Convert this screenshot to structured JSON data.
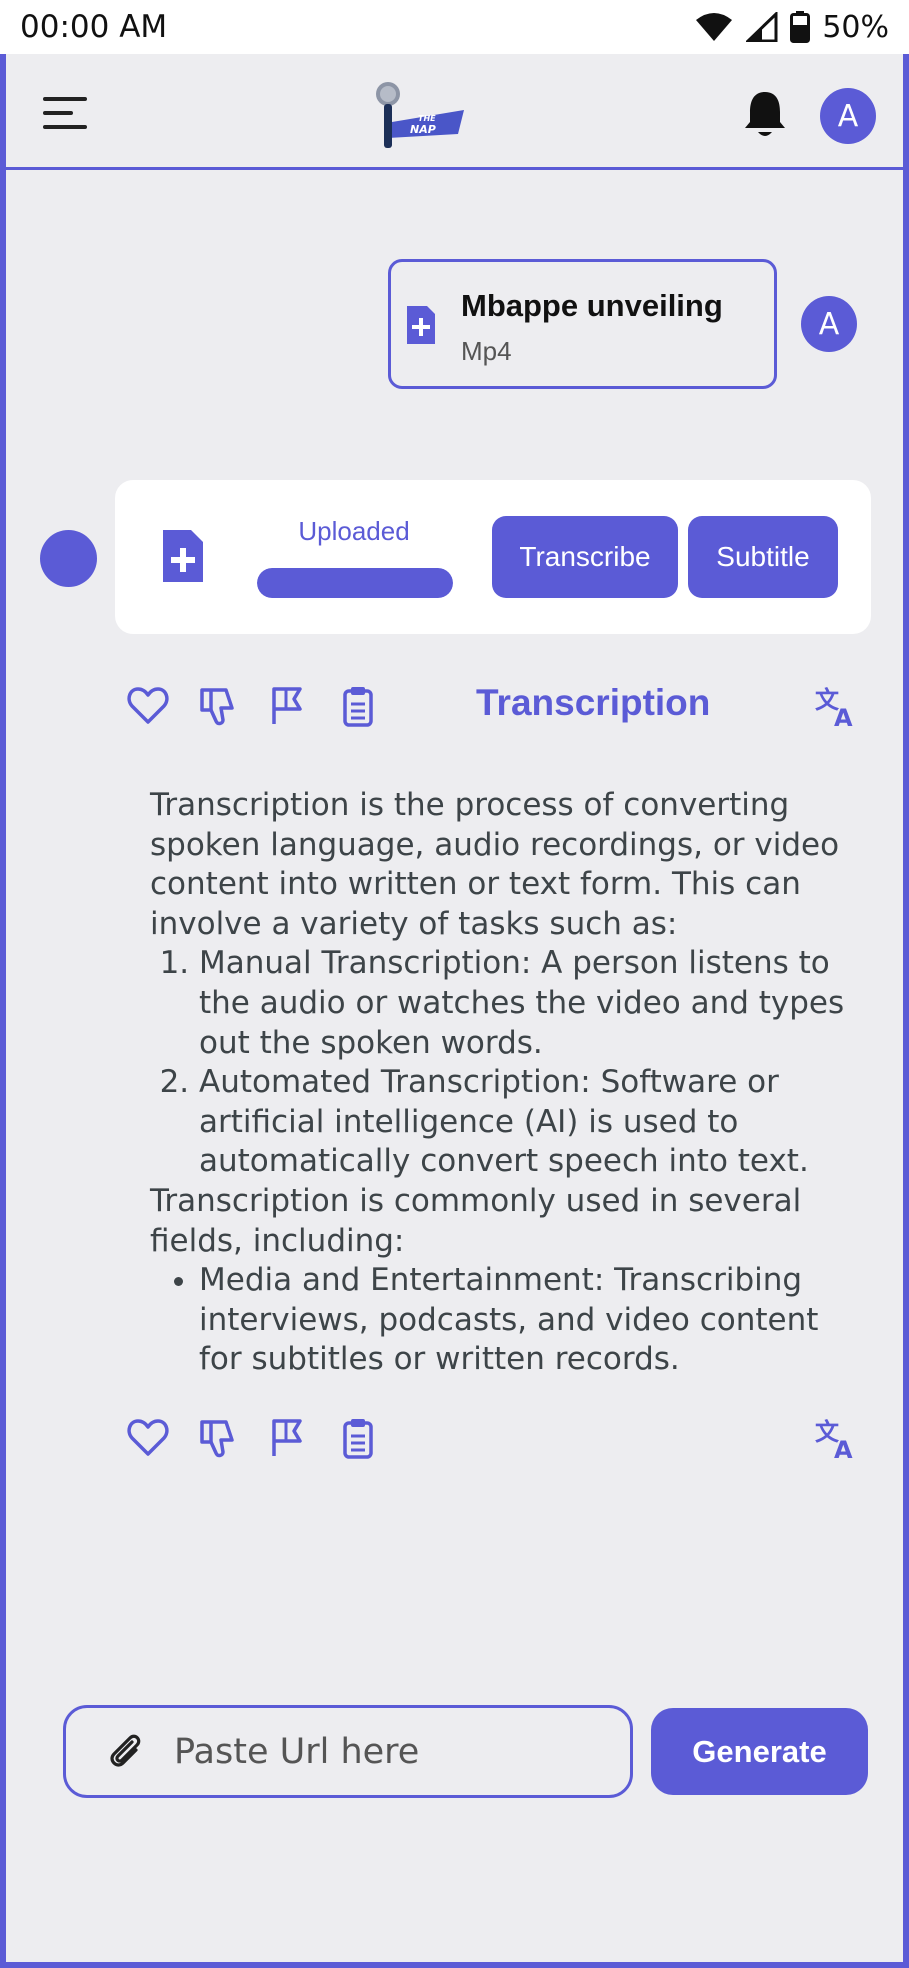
{
  "status_bar": {
    "time": "00:00 AM",
    "battery": "50%"
  },
  "header": {
    "logo_text_top": "THE",
    "logo_text_bottom": "NAP",
    "avatar_letter": "A"
  },
  "upload_message": {
    "file_name": "Mbappe unveiling",
    "file_type": "Mp4",
    "avatar_letter": "A"
  },
  "upload_status": {
    "label": "Uploaded",
    "progress": 1.0,
    "transcribe_label": "Transcribe",
    "subtitle_label": "Subtitle"
  },
  "transcription": {
    "title": "Transcription",
    "intro": "Transcription is the process of converting spoken language, audio recordings, or video content into written or text form. This can involve a variety of tasks such as:",
    "tasks": [
      "Manual Transcription: A person listens to the audio or watches the video and types out the spoken words.",
      "Automated Transcription: Software or artificial intelligence (AI) is used to automatically convert speech into text."
    ],
    "fields_intro": "Transcription is commonly used in several fields, including:",
    "fields": [
      "Media and Entertainment: Transcribing interviews, podcasts, and video content for subtitles or written records."
    ]
  },
  "input_bar": {
    "placeholder": "Paste Url here",
    "value": "",
    "generate_label": "Generate"
  },
  "colors": {
    "accent": "#5b5bd6",
    "background": "#ededf0",
    "text": "#3d4448"
  },
  "icons": {
    "menu": "hamburger-menu-icon",
    "notifications": "bell-icon",
    "file": "file-plus-icon",
    "like": "heart-icon",
    "dislike": "thumbs-down-icon",
    "report": "flag-icon",
    "copy": "clipboard-icon",
    "translate": "translate-icon",
    "attach": "paperclip-icon"
  }
}
